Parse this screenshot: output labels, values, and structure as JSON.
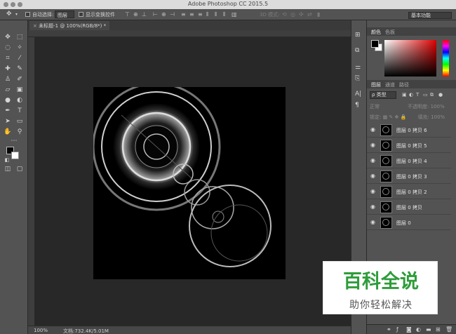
{
  "window": {
    "title": "Adobe Photoshop CC 2015.5"
  },
  "options_bar": {
    "auto_select_label": "自动选择:",
    "auto_select_value": "图层",
    "show_transform_label": "显示变换控件",
    "mode_3d_label": "3D 模式:",
    "workspace": "基本功能",
    "icons": [
      "move-tool-icon",
      "align-top-icon",
      "align-vcenter-icon",
      "align-bottom-icon",
      "align-left-icon",
      "align-hcenter-icon",
      "align-right-icon",
      "distribute-icon"
    ]
  },
  "document": {
    "tab_label": "未标题-1 @ 100%(RGB/8*) *",
    "zoom": "100%",
    "doc_info": "文档:732.4K/5.01M"
  },
  "color_panel": {
    "tabs": [
      "颜色",
      "色板"
    ],
    "foreground": "#000000",
    "background": "#ffffff",
    "hue_color": "#e00000"
  },
  "layers_panel": {
    "tabs": [
      "图层",
      "通道",
      "路径"
    ],
    "filter_label": "ρ 类型",
    "blend_mode": "正常",
    "opacity_label": "不透明度:",
    "opacity_value": "100%",
    "lock_label": "锁定:",
    "fill_label": "填充:",
    "fill_value": "100%",
    "layers": [
      {
        "name": "图层 0 拷贝 6"
      },
      {
        "name": "图层 0 拷贝 5"
      },
      {
        "name": "图层 0 拷贝 4"
      },
      {
        "name": "图层 0 拷贝 3"
      },
      {
        "name": "图层 0 拷贝 2"
      },
      {
        "name": "图层 0 拷贝"
      },
      {
        "name": "图层 0"
      }
    ]
  },
  "watermark": {
    "title": "百科全说",
    "subtitle": "助你轻松解决"
  }
}
